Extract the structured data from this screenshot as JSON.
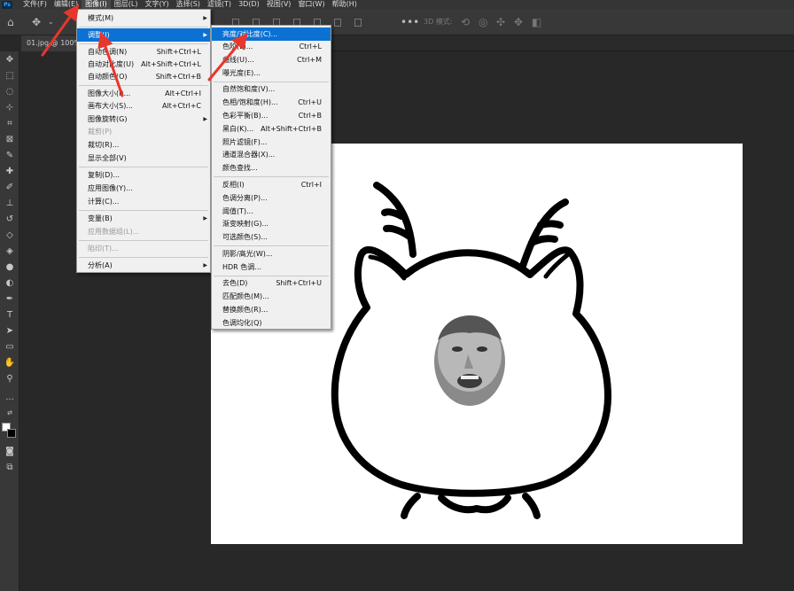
{
  "menubar": {
    "logo": "Ps",
    "items": [
      "文件(F)",
      "编辑(E)",
      "图像(I)",
      "图层(L)",
      "文字(Y)",
      "选择(S)",
      "滤镜(T)",
      "3D(D)",
      "视图(V)",
      "窗口(W)",
      "帮助(H)"
    ]
  },
  "optionsbar": {
    "mode_3d_label": "3D 模式:"
  },
  "document_tab": {
    "label": "01.jpg @ 100%"
  },
  "image_menu": {
    "items": [
      {
        "label": "模式(M)",
        "shortcut": "",
        "submenu": true,
        "disabled": false
      },
      {
        "label": "调整(J)",
        "shortcut": "",
        "submenu": true,
        "disabled": false,
        "highlighted": true
      },
      {
        "label": "自动色调(N)",
        "shortcut": "Shift+Ctrl+L",
        "submenu": false,
        "disabled": false
      },
      {
        "label": "自动对比度(U)",
        "shortcut": "Alt+Shift+Ctrl+L",
        "submenu": false,
        "disabled": false
      },
      {
        "label": "自动颜色(O)",
        "shortcut": "Shift+Ctrl+B",
        "submenu": false,
        "disabled": false
      },
      {
        "label": "图像大小(I)...",
        "shortcut": "Alt+Ctrl+I",
        "submenu": false,
        "disabled": false
      },
      {
        "label": "画布大小(S)...",
        "shortcut": "Alt+Ctrl+C",
        "submenu": false,
        "disabled": false
      },
      {
        "label": "图像旋转(G)",
        "shortcut": "",
        "submenu": true,
        "disabled": false
      },
      {
        "label": "裁剪(P)",
        "shortcut": "",
        "submenu": false,
        "disabled": true
      },
      {
        "label": "裁切(R)...",
        "shortcut": "",
        "submenu": false,
        "disabled": false
      },
      {
        "label": "显示全部(V)",
        "shortcut": "",
        "submenu": false,
        "disabled": false
      },
      {
        "label": "复制(D)...",
        "shortcut": "",
        "submenu": false,
        "disabled": false
      },
      {
        "label": "应用图像(Y)...",
        "shortcut": "",
        "submenu": false,
        "disabled": false
      },
      {
        "label": "计算(C)...",
        "shortcut": "",
        "submenu": false,
        "disabled": false
      },
      {
        "label": "变量(B)",
        "shortcut": "",
        "submenu": true,
        "disabled": false
      },
      {
        "label": "应用数据组(L)...",
        "shortcut": "",
        "submenu": false,
        "disabled": true
      },
      {
        "label": "陷印(T)...",
        "shortcut": "",
        "submenu": false,
        "disabled": true
      },
      {
        "label": "分析(A)",
        "shortcut": "",
        "submenu": true,
        "disabled": false
      }
    ]
  },
  "adjust_menu": {
    "items": [
      {
        "label": "亮度/对比度(C)...",
        "shortcut": "",
        "highlighted": true
      },
      {
        "label": "色阶(L)...",
        "shortcut": "Ctrl+L"
      },
      {
        "label": "曲线(U)...",
        "shortcut": "Ctrl+M"
      },
      {
        "label": "曝光度(E)...",
        "shortcut": ""
      },
      {
        "label": "自然饱和度(V)...",
        "shortcut": ""
      },
      {
        "label": "色相/饱和度(H)...",
        "shortcut": "Ctrl+U"
      },
      {
        "label": "色彩平衡(B)...",
        "shortcut": "Ctrl+B"
      },
      {
        "label": "黑白(K)...",
        "shortcut": "Alt+Shift+Ctrl+B"
      },
      {
        "label": "照片滤镜(F)...",
        "shortcut": ""
      },
      {
        "label": "通道混合器(X)...",
        "shortcut": ""
      },
      {
        "label": "颜色查找...",
        "shortcut": ""
      },
      {
        "label": "反相(I)",
        "shortcut": "Ctrl+I"
      },
      {
        "label": "色调分离(P)...",
        "shortcut": ""
      },
      {
        "label": "阈值(T)...",
        "shortcut": ""
      },
      {
        "label": "渐变映射(G)...",
        "shortcut": ""
      },
      {
        "label": "可选颜色(S)...",
        "shortcut": ""
      },
      {
        "label": "阴影/高光(W)...",
        "shortcut": ""
      },
      {
        "label": "HDR 色调...",
        "shortcut": ""
      },
      {
        "label": "去色(D)",
        "shortcut": "Shift+Ctrl+U"
      },
      {
        "label": "匹配颜色(M)...",
        "shortcut": ""
      },
      {
        "label": "替换颜色(R)...",
        "shortcut": ""
      },
      {
        "label": "色调均化(Q)",
        "shortcut": ""
      }
    ]
  },
  "colors": {
    "menu_highlight": "#0b72d4",
    "annotation_arrow": "#e8362d",
    "canvas_background": "#ffffff",
    "workspace_background": "#282828"
  }
}
